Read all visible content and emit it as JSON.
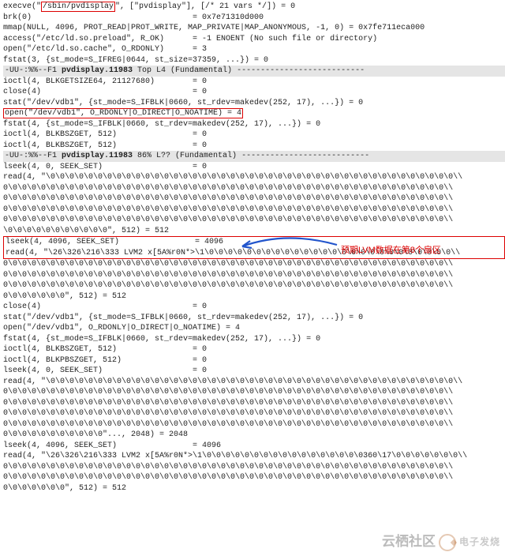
{
  "lines": [
    "execve(\"/sbin/pvdisplay\", [\"pvdisplay\"], [/* 21 vars */]) = 0",
    "brk(0)                                  = 0x7e71310d000",
    "mmap(NULL, 4096, PROT_READ|PROT_WRITE, MAP_PRIVATE|MAP_ANONYMOUS, -1, 0) = 0x7fe711eca000",
    "access(\"/etc/ld.so.preload\", R_OK)      = -1 ENOENT (No such file or directory)",
    "open(\"/etc/ld.so.cache\", O_RDONLY)      = 3",
    "fstat(3, {st_mode=S_IFREG|0644, st_size=37359, ...}) = 0"
  ],
  "status1": {
    "left": "-UU-:%%--F1",
    "file": "pvdisplay.11983",
    "pos": "Top L4",
    "mode": "(Fundamental)"
  },
  "lines2": [
    "ioctl(4, BLKGETSIZE64, 21127680)        = 0",
    "close(4)                                = 0",
    "stat(\"/dev/vdb1\", {st_mode=S_IFBLK|0660, st_rdev=makedev(252, 17), ...}) = 0"
  ],
  "boxed1": "open(\"/dev/vdb1\", O_RDONLY|O_DIRECT|O_NOATIME) = 4",
  "lines3": [
    "fstat(4, {st_mode=S_IFBLK|0660, st_rdev=makedev(252, 17), ...}) = 0",
    "ioctl(4, BLKBSZGET, 512)                = 0",
    "ioctl(4, BLKBSZGET, 512)                = 0"
  ],
  "status2": {
    "left": "-UU-:%%--F1",
    "file": "pvdisplay.11983",
    "pos": "86% L??",
    "mode": "(Fundamental)"
  },
  "lines4": [
    "lseek(4, 0, SEEK_SET)                   = 0",
    "read(4, \"\\0\\0\\0\\0\\0\\0\\0\\0\\0\\0\\0\\0\\0\\0\\0\\0\\0\\0\\0\\0\\0\\0\\0\\0\\0\\0\\0\\0\\0\\0\\0\\0\\0\\0\\0\\0\\0\\0\\0\\0\\0\\0\\0\\\\",
    "0\\0\\0\\0\\0\\0\\0\\0\\0\\0\\0\\0\\0\\0\\0\\0\\0\\0\\0\\0\\0\\0\\0\\0\\0\\0\\0\\0\\0\\0\\0\\0\\0\\0\\0\\0\\0\\0\\0\\0\\0\\0\\0\\0\\0\\0\\0\\\\",
    "0\\0\\0\\0\\0\\0\\0\\0\\0\\0\\0\\0\\0\\0\\0\\0\\0\\0\\0\\0\\0\\0\\0\\0\\0\\0\\0\\0\\0\\0\\0\\0\\0\\0\\0\\0\\0\\0\\0\\0\\0\\0\\0\\0\\0\\0\\0\\\\",
    "0\\0\\0\\0\\0\\0\\0\\0\\0\\0\\0\\0\\0\\0\\0\\0\\0\\0\\0\\0\\0\\0\\0\\0\\0\\0\\0\\0\\0\\0\\0\\0\\0\\0\\0\\0\\0\\0\\0\\0\\0\\0\\0\\0\\0\\0\\0\\\\",
    "0\\0\\0\\0\\0\\0\\0\\0\\0\\0\\0\\0\\0\\0\\0\\0\\0\\0\\0\\0\\0\\0\\0\\0\\0\\0\\0\\0\\0\\0\\0\\0\\0\\0\\0\\0\\0\\0\\0\\0\\0\\0\\0\\0\\0\\0\\0\\\\",
    "\\0\\0\\0\\0\\0\\0\\0\\0\\0\\0\\0\", 512) = 512"
  ],
  "boxed2": [
    "lseek(4, 4096, SEEK_SET)                = 4096",
    "read(4, \"\\26\\326\\216\\333 LVM2 x[5A%r0N*>\\1\\0\\0"
  ],
  "boxed2_cont": "\\0\\0\\0\\0\\0\\0\\0\\0\\0\\0\\0\\0\\0\\0\\0\\0\\0\\0\\0\\0\\0\\0\\0\\0\\\\",
  "lines5": [
    "0\\0\\0\\0\\0\\0\\0\\0\\0\\0\\0\\0\\0\\0\\0\\0\\0\\0\\0\\0\\0\\0\\0\\0\\0\\0\\0\\0\\0\\0\\0\\0\\0\\0\\0\\0\\0\\0\\0\\0\\0\\0\\0\\0\\0\\0\\0\\\\",
    "0\\0\\0\\0\\0\\0\\0\\0\\0\\0\\0\\0\\0\\0\\0\\0\\0\\0\\0\\0\\0\\0\\0\\0\\0\\0\\0\\0\\0\\0\\0\\0\\0\\0\\0\\0\\0\\0\\0\\0\\0\\0\\0\\0\\0\\0\\0\\\\",
    "0\\0\\0\\0\\0\\0\\0\\0\\0\\0\\0\\0\\0\\0\\0\\0\\0\\0\\0\\0\\0\\0\\0\\0\\0\\0\\0\\0\\0\\0\\0\\0\\0\\0\\0\\0\\0\\0\\0\\0\\0\\0\\0\\0\\0\\0\\0\\\\",
    "0\\0\\0\\0\\0\\0\\0\", 512) = 512",
    "close(4)                                = 0",
    "stat(\"/dev/vdb1\", {st_mode=S_IFBLK|0660, st_rdev=makedev(252, 17), ...}) = 0",
    "open(\"/dev/vdb1\", O_RDONLY|O_DIRECT|O_NOATIME) = 4",
    "fstat(4, {st_mode=S_IFBLK|0660, st_rdev=makedev(252, 17), ...}) = 0",
    "ioctl(4, BLKBSZGET, 512)                = 0",
    "ioctl(4, BLKPBSZGET, 512)               = 0",
    "lseek(4, 0, SEEK_SET)                   = 0",
    "read(4, \"\\0\\0\\0\\0\\0\\0\\0\\0\\0\\0\\0\\0\\0\\0\\0\\0\\0\\0\\0\\0\\0\\0\\0\\0\\0\\0\\0\\0\\0\\0\\0\\0\\0\\0\\0\\0\\0\\0\\0\\0\\0\\0\\0\\\\",
    "0\\0\\0\\0\\0\\0\\0\\0\\0\\0\\0\\0\\0\\0\\0\\0\\0\\0\\0\\0\\0\\0\\0\\0\\0\\0\\0\\0\\0\\0\\0\\0\\0\\0\\0\\0\\0\\0\\0\\0\\0\\0\\0\\0\\0\\0\\0\\\\",
    "0\\0\\0\\0\\0\\0\\0\\0\\0\\0\\0\\0\\0\\0\\0\\0\\0\\0\\0\\0\\0\\0\\0\\0\\0\\0\\0\\0\\0\\0\\0\\0\\0\\0\\0\\0\\0\\0\\0\\0\\0\\0\\0\\0\\0\\0\\0\\\\",
    "0\\0\\0\\0\\0\\0\\0\\0\\0\\0\\0\\0\\0\\0\\0\\0\\0\\0\\0\\0\\0\\0\\0\\0\\0\\0\\0\\0\\0\\0\\0\\0\\0\\0\\0\\0\\0\\0\\0\\0\\0\\0\\0\\0\\0\\0\\0\\\\",
    "0\\0\\0\\0\\0\\0\\0\\0\\0\\0\\0\\0\\0\\0\\0\\0\\0\\0\\0\\0\\0\\0\\0\\0\\0\\0\\0\\0\\0\\0\\0\\0\\0\\0\\0\\0\\0\\0\\0\\0\\0\\0\\0\\0\\0\\0\\0\\\\",
    "0\\0\\0\\0\\0\\0\\0\\0\\0\\0\\0\"..., 2048) = 2048",
    "lseek(4, 4096, SEEK_SET)                = 4096",
    "read(4, \"\\26\\326\\216\\333 LVM2 x[5A%r0N*>\\1\\0\\0\\0\\0\\0\\0\\0\\0\\0\\0\\0\\0\\0\\0\\0\\0\\0360\\17\\0\\0\\0\\0\\0\\0\\0\\\\",
    "0\\0\\0\\0\\0\\0\\0\\0\\0\\0\\0\\0\\0\\0\\0\\0\\0\\0\\0\\0\\0\\0\\0\\0\\0\\0\\0\\0\\0\\0\\0\\0\\0\\0\\0\\0\\0\\0\\0\\0\\0\\0\\0\\0\\0\\0\\0\\\\",
    "0\\0\\0\\0\\0\\0\\0\\0\\0\\0\\0\\0\\0\\0\\0\\0\\0\\0\\0\\0\\0\\0\\0\\0\\0\\0\\0\\0\\0\\0\\0\\0\\0\\0\\0\\0\\0\\0\\0\\0\\0\\0\\0\\0\\0\\0\\0\\\\",
    "0\\0\\0\\0\\0\\0\\0\", 512) = 512",
    "close(4)                                = 0"
  ],
  "hl_path": "/sbin/pvdisplay",
  "annotation_text": "预期LVM数据在第8个扇区",
  "watermark": {
    "text": "云栖社区",
    "brand": "电子发烧"
  }
}
